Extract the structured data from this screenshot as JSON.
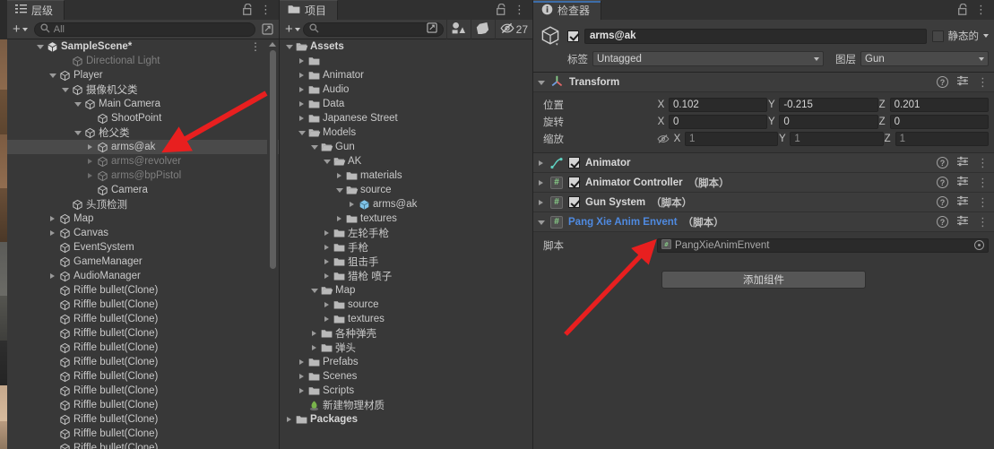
{
  "hierarchy": {
    "tab_label": "层级",
    "tab_icon": "hierarchy-icon",
    "toolbar": {
      "add_label": "+",
      "search_placeholder": "All",
      "search_value": ""
    },
    "items": [
      {
        "label": "SampleScene*",
        "indent": 1,
        "twisty": "down",
        "icon": "unity-scene-icon",
        "style": "bold",
        "kebab": true
      },
      {
        "label": "Directional Light",
        "indent": 3,
        "twisty": "none",
        "icon": "gameobject-cube-icon",
        "style": "dim"
      },
      {
        "label": "Player",
        "indent": 2,
        "twisty": "down",
        "icon": "gameobject-cube-icon",
        "style": "normal"
      },
      {
        "label": "摄像机父类",
        "indent": 3,
        "twisty": "down",
        "icon": "gameobject-cube-icon",
        "style": "normal"
      },
      {
        "label": "Main Camera",
        "indent": 4,
        "twisty": "down",
        "icon": "gameobject-cube-icon",
        "style": "normal"
      },
      {
        "label": "ShootPoint",
        "indent": 5,
        "twisty": "none",
        "icon": "gameobject-cube-icon",
        "style": "normal"
      },
      {
        "label": "枪父类",
        "indent": 4,
        "twisty": "down",
        "icon": "gameobject-cube-icon",
        "style": "normal"
      },
      {
        "label": "arms@ak",
        "indent": 5,
        "twisty": "right",
        "icon": "gameobject-cube-icon",
        "style": "selected"
      },
      {
        "label": "arms@revolver",
        "indent": 5,
        "twisty": "right",
        "icon": "gameobject-cube-icon",
        "style": "dim"
      },
      {
        "label": "arms@bpPistol",
        "indent": 5,
        "twisty": "right",
        "icon": "gameobject-cube-icon",
        "style": "dim"
      },
      {
        "label": "Camera",
        "indent": 5,
        "twisty": "none",
        "icon": "gameobject-cube-icon",
        "style": "normal"
      },
      {
        "label": "头顶检测",
        "indent": 3,
        "twisty": "none",
        "icon": "gameobject-cube-icon",
        "style": "normal"
      },
      {
        "label": "Map",
        "indent": 2,
        "twisty": "right",
        "icon": "gameobject-cube-icon",
        "style": "normal"
      },
      {
        "label": "Canvas",
        "indent": 2,
        "twisty": "right",
        "icon": "gameobject-cube-icon",
        "style": "normal"
      },
      {
        "label": "EventSystem",
        "indent": 2,
        "twisty": "none",
        "icon": "gameobject-cube-icon",
        "style": "normal"
      },
      {
        "label": "GameManager",
        "indent": 2,
        "twisty": "none",
        "icon": "gameobject-cube-icon",
        "style": "normal"
      },
      {
        "label": "AudioManager",
        "indent": 2,
        "twisty": "right",
        "icon": "gameobject-cube-icon",
        "style": "normal"
      },
      {
        "label": "Riffle bullet(Clone)",
        "indent": 2,
        "twisty": "none",
        "icon": "gameobject-cube-icon",
        "style": "normal"
      },
      {
        "label": "Riffle bullet(Clone)",
        "indent": 2,
        "twisty": "none",
        "icon": "gameobject-cube-icon",
        "style": "normal"
      },
      {
        "label": "Riffle bullet(Clone)",
        "indent": 2,
        "twisty": "none",
        "icon": "gameobject-cube-icon",
        "style": "normal"
      },
      {
        "label": "Riffle bullet(Clone)",
        "indent": 2,
        "twisty": "none",
        "icon": "gameobject-cube-icon",
        "style": "normal"
      },
      {
        "label": "Riffle bullet(Clone)",
        "indent": 2,
        "twisty": "none",
        "icon": "gameobject-cube-icon",
        "style": "normal"
      },
      {
        "label": "Riffle bullet(Clone)",
        "indent": 2,
        "twisty": "none",
        "icon": "gameobject-cube-icon",
        "style": "normal"
      },
      {
        "label": "Riffle bullet(Clone)",
        "indent": 2,
        "twisty": "none",
        "icon": "gameobject-cube-icon",
        "style": "normal"
      },
      {
        "label": "Riffle bullet(Clone)",
        "indent": 2,
        "twisty": "none",
        "icon": "gameobject-cube-icon",
        "style": "normal"
      },
      {
        "label": "Riffle bullet(Clone)",
        "indent": 2,
        "twisty": "none",
        "icon": "gameobject-cube-icon",
        "style": "normal"
      },
      {
        "label": "Riffle bullet(Clone)",
        "indent": 2,
        "twisty": "none",
        "icon": "gameobject-cube-icon",
        "style": "normal"
      },
      {
        "label": "Riffle bullet(Clone)",
        "indent": 2,
        "twisty": "none",
        "icon": "gameobject-cube-icon",
        "style": "normal"
      },
      {
        "label": "Riffle bullet(Clone)",
        "indent": 2,
        "twisty": "none",
        "icon": "gameobject-cube-icon",
        "style": "normal"
      }
    ]
  },
  "project": {
    "tab_label": "项目",
    "tab_icon": "folder-icon",
    "toolbar": {
      "add_label": "+",
      "search_placeholder": "",
      "search_value": "",
      "tool_shapes_icon": "shapes-filter-icon",
      "tool_tag_icon": "label-filter-icon",
      "hidden_count_icon": "eye-off-icon",
      "hidden_count": "27"
    },
    "items": [
      {
        "label": "Assets",
        "indent": 0,
        "twisty": "down",
        "icon": "folder-open-icon",
        "style": "bold"
      },
      {
        "label": "",
        "indent": 1,
        "twisty": "right",
        "icon": "folder-icon",
        "style": "normal"
      },
      {
        "label": "Animator",
        "indent": 1,
        "twisty": "right",
        "icon": "folder-icon",
        "style": "normal"
      },
      {
        "label": "Audio",
        "indent": 1,
        "twisty": "right",
        "icon": "folder-icon",
        "style": "normal"
      },
      {
        "label": "Data",
        "indent": 1,
        "twisty": "right",
        "icon": "folder-icon",
        "style": "normal"
      },
      {
        "label": "Japanese Street",
        "indent": 1,
        "twisty": "right",
        "icon": "folder-icon",
        "style": "normal"
      },
      {
        "label": "Models",
        "indent": 1,
        "twisty": "down",
        "icon": "folder-open-icon",
        "style": "normal"
      },
      {
        "label": "Gun",
        "indent": 2,
        "twisty": "down",
        "icon": "folder-open-icon",
        "style": "normal"
      },
      {
        "label": "AK",
        "indent": 3,
        "twisty": "down",
        "icon": "folder-open-icon",
        "style": "normal"
      },
      {
        "label": "materials",
        "indent": 4,
        "twisty": "right",
        "icon": "folder-icon",
        "style": "normal"
      },
      {
        "label": "source",
        "indent": 4,
        "twisty": "down",
        "icon": "folder-open-icon",
        "style": "normal"
      },
      {
        "label": "arms@ak",
        "indent": 5,
        "twisty": "right",
        "icon": "model-prefab-icon",
        "style": "normal"
      },
      {
        "label": "textures",
        "indent": 4,
        "twisty": "right",
        "icon": "folder-icon",
        "style": "normal"
      },
      {
        "label": "左轮手枪",
        "indent": 3,
        "twisty": "right",
        "icon": "folder-icon",
        "style": "normal"
      },
      {
        "label": "手枪",
        "indent": 3,
        "twisty": "right",
        "icon": "folder-icon",
        "style": "normal"
      },
      {
        "label": "狙击手",
        "indent": 3,
        "twisty": "right",
        "icon": "folder-icon",
        "style": "normal"
      },
      {
        "label": "猎枪 喷子",
        "indent": 3,
        "twisty": "right",
        "icon": "folder-icon",
        "style": "normal"
      },
      {
        "label": "Map",
        "indent": 2,
        "twisty": "down",
        "icon": "folder-open-icon",
        "style": "normal"
      },
      {
        "label": "source",
        "indent": 3,
        "twisty": "right",
        "icon": "folder-icon",
        "style": "normal"
      },
      {
        "label": "textures",
        "indent": 3,
        "twisty": "right",
        "icon": "folder-icon",
        "style": "normal"
      },
      {
        "label": "各种弹壳",
        "indent": 2,
        "twisty": "right",
        "icon": "folder-icon",
        "style": "normal"
      },
      {
        "label": "弹头",
        "indent": 2,
        "twisty": "right",
        "icon": "folder-icon",
        "style": "normal"
      },
      {
        "label": "Prefabs",
        "indent": 1,
        "twisty": "right",
        "icon": "folder-icon",
        "style": "normal"
      },
      {
        "label": "Scenes",
        "indent": 1,
        "twisty": "right",
        "icon": "folder-icon",
        "style": "normal"
      },
      {
        "label": "Scripts",
        "indent": 1,
        "twisty": "right",
        "icon": "folder-icon",
        "style": "normal"
      },
      {
        "label": "新建物理材质",
        "indent": 1,
        "twisty": "none",
        "icon": "physics-material-icon",
        "style": "normal"
      },
      {
        "label": "Packages",
        "indent": 0,
        "twisty": "right",
        "icon": "folder-icon",
        "style": "bold"
      }
    ]
  },
  "inspector": {
    "tab_label": "检查器",
    "tab_icon": "info-icon",
    "object": {
      "enabled": true,
      "name": "arms@ak",
      "static_label": "静态的",
      "static_checked": false,
      "tag_label": "标签",
      "tag_value": "Untagged",
      "layer_label": "图层",
      "layer_value": "Gun"
    },
    "transform": {
      "title": "Transform",
      "position_label": "位置",
      "rotation_label": "旋转",
      "scale_label": "缩放",
      "axes": [
        "X",
        "Y",
        "Z"
      ],
      "position": [
        "0.102",
        "-0.215",
        "0.201"
      ],
      "rotation": [
        "0",
        "0",
        "0"
      ],
      "scale": [
        "1",
        "1",
        "1"
      ]
    },
    "components": [
      {
        "title": "Animator",
        "suffix": "",
        "icon": "animator-icon",
        "enabled": true,
        "has_checkbox": true,
        "expanded": false,
        "blue": false
      },
      {
        "title": "Animator Controller",
        "suffix": "（脚本）",
        "icon": "csharp-script-icon",
        "enabled": true,
        "has_checkbox": true,
        "expanded": false,
        "blue": false
      },
      {
        "title": "Gun System",
        "suffix": "（脚本）",
        "icon": "csharp-script-icon",
        "enabled": true,
        "has_checkbox": true,
        "expanded": false,
        "blue": false
      },
      {
        "title": "Pang Xie Anim Envent",
        "suffix": "（脚本）",
        "icon": "csharp-script-icon",
        "enabled": false,
        "has_checkbox": false,
        "expanded": true,
        "blue": true
      }
    ],
    "script_row": {
      "label": "脚本",
      "value": "PangXieAnimEnvent",
      "value_icon": "csharp-script-icon"
    },
    "add_component_label": "添加组件"
  },
  "annotations": {
    "arrow_color": "#e81f1f",
    "arrows": [
      {
        "name": "arrow-to-arms-at-ak",
        "from": [
          297,
          104
        ],
        "to": [
          196,
          162
        ]
      },
      {
        "name": "arrow-to-script-field",
        "from": [
          631,
          373
        ],
        "to": [
          722,
          278
        ]
      }
    ]
  },
  "colors": {
    "panel_bg": "#383838",
    "header_bg": "#3c3c3c",
    "tabbar_bg": "#303030",
    "selection": "#4a4a4a",
    "field_bg": "#2a2a2a",
    "text": "#c9c9c9",
    "text_dim": "#7f7f7f",
    "accent_blue": "#4f8ae0"
  }
}
